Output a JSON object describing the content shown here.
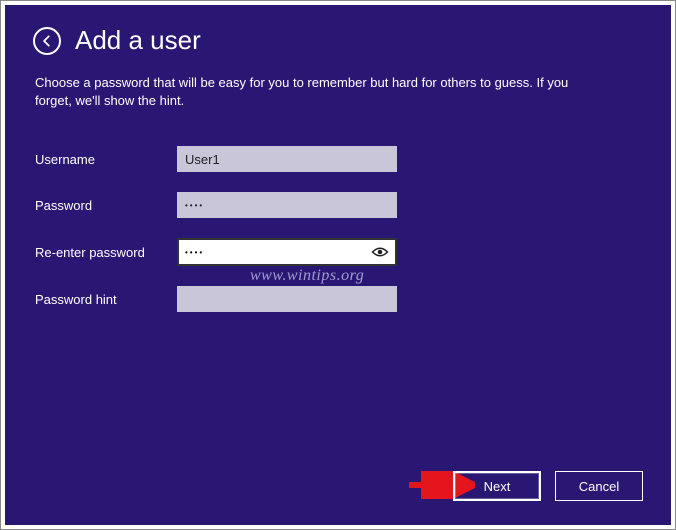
{
  "header": {
    "title": "Add a user"
  },
  "subtitle": "Choose a password that will be easy for you to remember but hard for others to guess. If you forget, we'll show the hint.",
  "form": {
    "username_label": "Username",
    "username_value": "User1",
    "password_label": "Password",
    "password_value": "••••",
    "reenter_label": "Re-enter password",
    "reenter_value": "••••",
    "hint_label": "Password hint",
    "hint_value": ""
  },
  "footer": {
    "next_label": "Next",
    "cancel_label": "Cancel"
  },
  "watermark": "www.wintips.org",
  "colors": {
    "background": "#2a1773",
    "field_bg": "#c8c6d8"
  }
}
